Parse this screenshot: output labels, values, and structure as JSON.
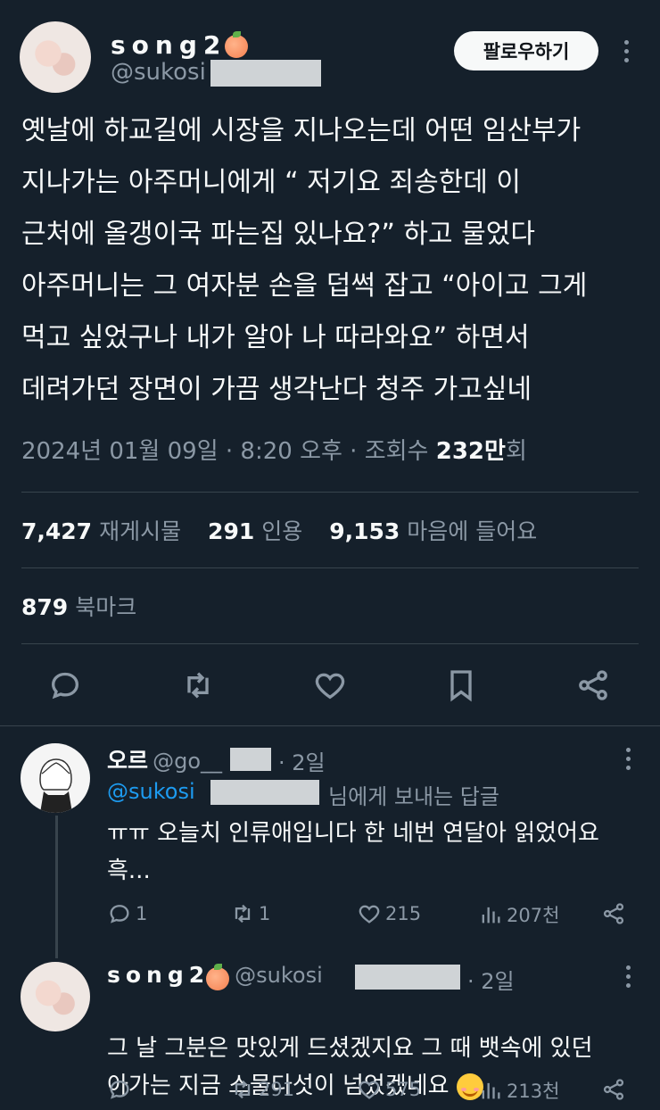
{
  "main": {
    "name": "song2",
    "handle": "@sukosi",
    "follow_label": "팔로우하기",
    "body": "옛날에 하교길에 시장을 지나오는데 어떤 임산부가\n지나가는 아주머니에게 “ 저기요 죄송한데 이\n근처에 올갱이국 파는집 있나요?” 하고 물었다\n아주머니는 그 여자분 손을 덥썩 잡고 “아이고 그게\n먹고 싶었구나 내가 알아 나 따라와요” 하면서\n데려가던 장면이 가끔 생각난다 청주 가고싶네",
    "meta_prefix": "2024년 01월 09일 · 8:20 오후 · 조회수 ",
    "views_value": "232만",
    "views_suffix": "회",
    "stats": {
      "retweets": "7,427",
      "retweets_label": "재게시물",
      "quotes": "291",
      "quotes_label": "인용",
      "likes": "9,153",
      "likes_label": "마음에 들어요",
      "bookmarks": "879",
      "bookmarks_label": "북마크"
    }
  },
  "reply1": {
    "name": "오르",
    "handle": "@go__",
    "time": "· 2일",
    "replying_handle": "@sukosi",
    "replying_suffix": "님에게 보내는 답글",
    "text": "ㅠㅠ 오늘치 인류애입니다 한 네번 연달아 읽었어요\n흑...",
    "replies": "1",
    "retweets": "1",
    "likes": "215",
    "views": "207천"
  },
  "reply2": {
    "name": "song2",
    "handle": "@sukosi",
    "time": "· 2일",
    "text": "그 날 그분은 맛있게 드셨겠지요 그 때 뱃속에 있던\n아가는 지금 스물다섯이 넘었겠네요",
    "replies": "",
    "retweets": "291",
    "likes": "575",
    "views": "213천"
  }
}
